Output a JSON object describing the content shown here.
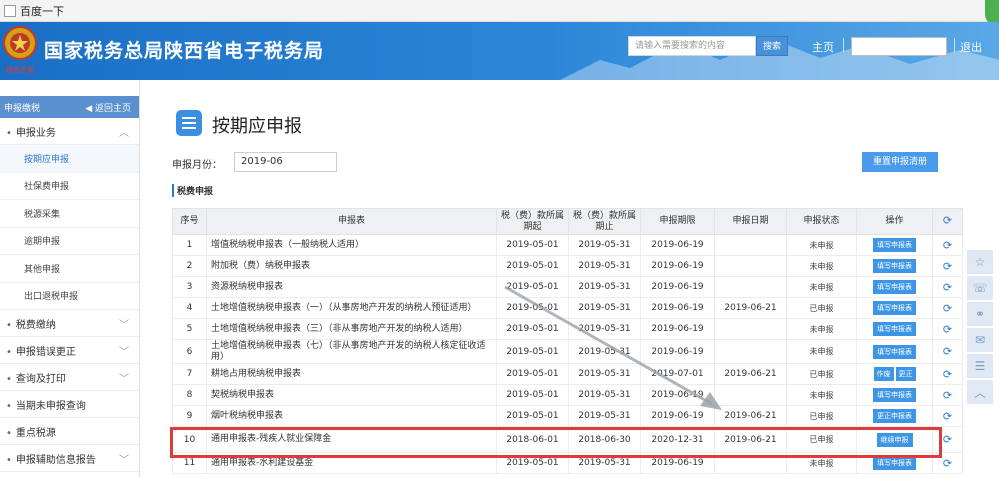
{
  "window": {
    "title": "百度一下"
  },
  "header": {
    "site_title": "国家税务总局陕西省电子税务局",
    "emblem_caption": "税务总局",
    "search_placeholder": "请输入需要搜索的内容",
    "search_button": "搜索",
    "home_link": "主页",
    "user_name": "",
    "logout_link": "退出"
  },
  "sidebar": {
    "head_label": "申报缴税",
    "back_label": "返回主页",
    "groups": [
      {
        "label": "申报业务",
        "expanded": true
      },
      {
        "label": "税费缴纳"
      },
      {
        "label": "申报错误更正"
      },
      {
        "label": "查询及打印"
      },
      {
        "label": "当期未申报查询"
      },
      {
        "label": "重点税源"
      },
      {
        "label": "申报辅助信息报告"
      }
    ],
    "sub_items": [
      {
        "label": "按期应申报",
        "active": true
      },
      {
        "label": "社保费申报"
      },
      {
        "label": "税源采集"
      },
      {
        "label": "逾期申报"
      },
      {
        "label": "其他申报"
      },
      {
        "label": "出口退税申报"
      }
    ]
  },
  "main": {
    "page_title": "按期应申报",
    "period_label": "申报月份：",
    "period_value": "2019-06",
    "reset_button": "重置申报清册",
    "section_label": "税费申报",
    "table": {
      "headers": [
        "序号",
        "申报表",
        "税（费）款所属期起",
        "税（费）款所属期止",
        "申报期限",
        "申报日期",
        "申报状态",
        "操作"
      ],
      "rows": [
        {
          "no": "1",
          "name": "增值税纳税申报表（一般纳税人适用）",
          "start": "2019-05-01",
          "end": "2019-05-31",
          "deadline": "2019-06-19",
          "date": "",
          "status": "未申报",
          "ops": [
            "填写申报表"
          ]
        },
        {
          "no": "2",
          "name": "附加税（费）纳税申报表",
          "start": "2019-05-01",
          "end": "2019-05-31",
          "deadline": "2019-06-19",
          "date": "",
          "status": "未申报",
          "ops": [
            "填写申报表"
          ]
        },
        {
          "no": "3",
          "name": "资源税纳税申报表",
          "start": "2019-05-01",
          "end": "2019-05-31",
          "deadline": "2019-06-19",
          "date": "",
          "status": "未申报",
          "ops": [
            "填写申报表"
          ]
        },
        {
          "no": "4",
          "name": "土地增值税纳税申报表（一）（从事房地产开发的纳税人预征适用）",
          "start": "2019-05-01",
          "end": "2019-05-31",
          "deadline": "2019-06-19",
          "date": "2019-06-21",
          "status": "已申报",
          "ops": [
            "填写申报表"
          ]
        },
        {
          "no": "5",
          "name": "土地增值税纳税申报表（三）（非从事房地产开发的纳税人适用）",
          "start": "2019-05-01",
          "end": "2019-05-31",
          "deadline": "2019-06-19",
          "date": "",
          "status": "未申报",
          "ops": [
            "填写申报表"
          ]
        },
        {
          "no": "6",
          "name": "土地增值税纳税申报表（七）（非从事房地产开发的纳税人核定征收适用）",
          "start": "2019-05-01",
          "end": "2019-05-31",
          "deadline": "2019-06-19",
          "date": "",
          "status": "未申报",
          "ops": [
            "填写申报表"
          ]
        },
        {
          "no": "7",
          "name": "耕地占用税纳税申报表",
          "start": "2019-05-01",
          "end": "2019-05-31",
          "deadline": "2019-07-01",
          "date": "2019-06-21",
          "status": "已申报",
          "ops": [
            "作废",
            "更正"
          ]
        },
        {
          "no": "8",
          "name": "契税纳税申报表",
          "start": "2019-05-01",
          "end": "2019-05-31",
          "deadline": "2019-06-19",
          "date": "",
          "status": "未申报",
          "ops": [
            "填写申报表"
          ]
        },
        {
          "no": "9",
          "name": "烟叶税纳税申报表",
          "start": "2019-05-01",
          "end": "2019-05-31",
          "deadline": "2019-06-19",
          "date": "2019-06-21",
          "status": "已申报",
          "ops": [
            "更正申报表"
          ]
        },
        {
          "no": "10",
          "name": "通用申报表-残疾人就业保障金",
          "start": "2018-06-01",
          "end": "2018-06-30",
          "deadline": "2020-12-31",
          "date": "2019-06-21",
          "status": "已申报",
          "ops": [
            "继续申报"
          ]
        },
        {
          "no": "11",
          "name": "通用申报表-水利建设基金",
          "start": "2019-05-01",
          "end": "2019-05-31",
          "deadline": "2019-06-19",
          "date": "",
          "status": "未申报",
          "ops": [
            "填写申报表"
          ]
        }
      ]
    }
  },
  "colors": {
    "accent": "#2a7ad1",
    "button": "#3d95e6",
    "highlight": "#e03a3a",
    "header": "#1a6fc4"
  },
  "icons": {
    "refresh": "refresh-icon",
    "rail": [
      "star-icon",
      "chat-icon",
      "link-icon",
      "message-icon",
      "document-icon",
      "up-arrow-icon"
    ]
  }
}
